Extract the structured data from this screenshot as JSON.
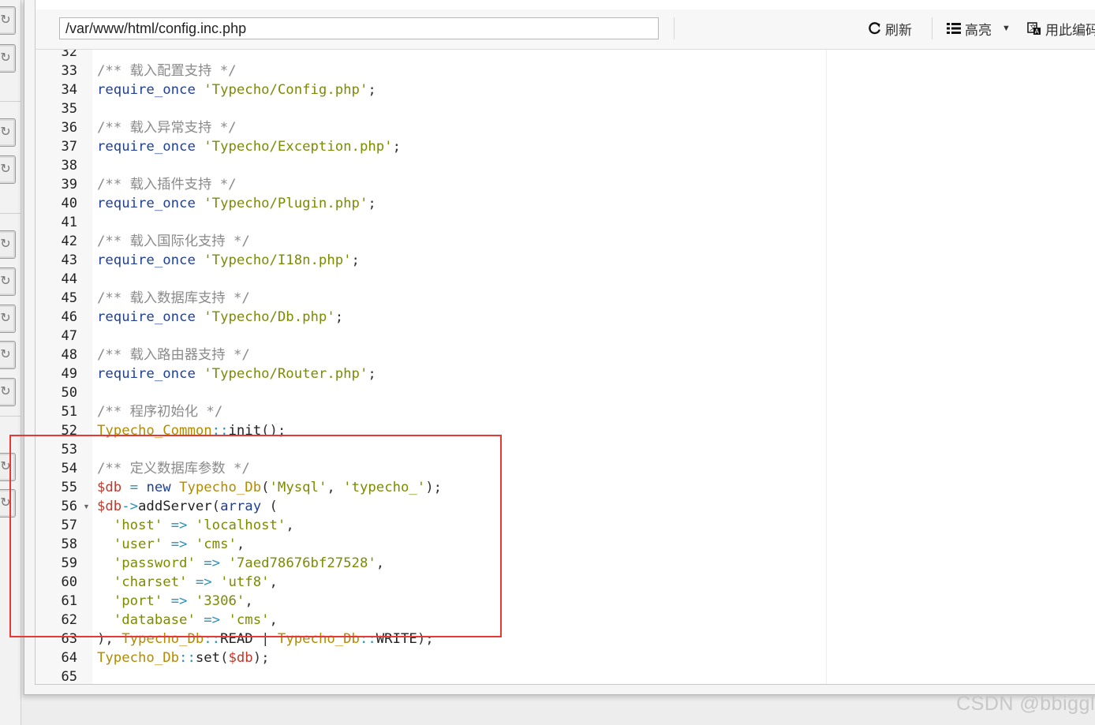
{
  "toolbar": {
    "file_path": "/var/www/html/config.inc.php",
    "refresh_label": "刷新",
    "highlight_label": "高亮",
    "encoding_label": "用此编码"
  },
  "code_lines": [
    {
      "n": "32",
      "t": []
    },
    {
      "n": "33",
      "t": [
        [
          "cm",
          "/** 载入配置支持 */"
        ]
      ]
    },
    {
      "n": "34",
      "t": [
        [
          "kw",
          "require_once"
        ],
        [
          "op",
          " "
        ],
        [
          "str",
          "'Typecho/Config.php'"
        ],
        [
          "op",
          ";"
        ]
      ]
    },
    {
      "n": "35",
      "t": []
    },
    {
      "n": "36",
      "t": [
        [
          "cm",
          "/** 载入异常支持 */"
        ]
      ]
    },
    {
      "n": "37",
      "t": [
        [
          "kw",
          "require_once"
        ],
        [
          "op",
          " "
        ],
        [
          "str",
          "'Typecho/Exception.php'"
        ],
        [
          "op",
          ";"
        ]
      ]
    },
    {
      "n": "38",
      "t": []
    },
    {
      "n": "39",
      "t": [
        [
          "cm",
          "/** 载入插件支持 */"
        ]
      ]
    },
    {
      "n": "40",
      "t": [
        [
          "kw",
          "require_once"
        ],
        [
          "op",
          " "
        ],
        [
          "str",
          "'Typecho/Plugin.php'"
        ],
        [
          "op",
          ";"
        ]
      ]
    },
    {
      "n": "41",
      "t": []
    },
    {
      "n": "42",
      "t": [
        [
          "cm",
          "/** 载入国际化支持 */"
        ]
      ]
    },
    {
      "n": "43",
      "t": [
        [
          "kw",
          "require_once"
        ],
        [
          "op",
          " "
        ],
        [
          "str",
          "'Typecho/I18n.php'"
        ],
        [
          "op",
          ";"
        ]
      ]
    },
    {
      "n": "44",
      "t": []
    },
    {
      "n": "45",
      "t": [
        [
          "cm",
          "/** 载入数据库支持 */"
        ]
      ]
    },
    {
      "n": "46",
      "t": [
        [
          "kw",
          "require_once"
        ],
        [
          "op",
          " "
        ],
        [
          "str",
          "'Typecho/Db.php'"
        ],
        [
          "op",
          ";"
        ]
      ]
    },
    {
      "n": "47",
      "t": []
    },
    {
      "n": "48",
      "t": [
        [
          "cm",
          "/** 载入路由器支持 */"
        ]
      ]
    },
    {
      "n": "49",
      "t": [
        [
          "kw",
          "require_once"
        ],
        [
          "op",
          " "
        ],
        [
          "str",
          "'Typecho/Router.php'"
        ],
        [
          "op",
          ";"
        ]
      ]
    },
    {
      "n": "50",
      "t": []
    },
    {
      "n": "51",
      "t": [
        [
          "cm",
          "/** 程序初始化 */"
        ]
      ]
    },
    {
      "n": "52",
      "t": [
        [
          "cls",
          "Typecho_Common"
        ],
        [
          "arr",
          "::"
        ],
        [
          "fn",
          "init"
        ],
        [
          "op",
          "();"
        ]
      ]
    },
    {
      "n": "53",
      "t": []
    },
    {
      "n": "54",
      "t": [
        [
          "cm",
          "/** 定义数据库参数 */"
        ]
      ]
    },
    {
      "n": "55",
      "t": [
        [
          "var",
          "$db"
        ],
        [
          "op",
          " "
        ],
        [
          "arr",
          "="
        ],
        [
          "op",
          " "
        ],
        [
          "kw",
          "new"
        ],
        [
          "op",
          " "
        ],
        [
          "cls",
          "Typecho_Db"
        ],
        [
          "op",
          "("
        ],
        [
          "str",
          "'Mysql'"
        ],
        [
          "op",
          ", "
        ],
        [
          "str",
          "'typecho_'"
        ],
        [
          "op",
          ");"
        ]
      ]
    },
    {
      "n": "56",
      "fold": true,
      "t": [
        [
          "var",
          "$db"
        ],
        [
          "arr",
          "->"
        ],
        [
          "fn",
          "addServer"
        ],
        [
          "op",
          "("
        ],
        [
          "kw",
          "array"
        ],
        [
          "op",
          " ("
        ]
      ]
    },
    {
      "n": "57",
      "t": [
        [
          "op",
          "  "
        ],
        [
          "str",
          "'host'"
        ],
        [
          "op",
          " "
        ],
        [
          "arr",
          "=>"
        ],
        [
          "op",
          " "
        ],
        [
          "str",
          "'localhost'"
        ],
        [
          "op",
          ","
        ]
      ]
    },
    {
      "n": "58",
      "t": [
        [
          "op",
          "  "
        ],
        [
          "str",
          "'user'"
        ],
        [
          "op",
          " "
        ],
        [
          "arr",
          "=>"
        ],
        [
          "op",
          " "
        ],
        [
          "str",
          "'cms'"
        ],
        [
          "op",
          ","
        ]
      ]
    },
    {
      "n": "59",
      "t": [
        [
          "op",
          "  "
        ],
        [
          "str",
          "'password'"
        ],
        [
          "op",
          " "
        ],
        [
          "arr",
          "=>"
        ],
        [
          "op",
          " "
        ],
        [
          "str",
          "'7aed78676bf27528'"
        ],
        [
          "op",
          ","
        ]
      ]
    },
    {
      "n": "60",
      "t": [
        [
          "op",
          "  "
        ],
        [
          "str",
          "'charset'"
        ],
        [
          "op",
          " "
        ],
        [
          "arr",
          "=>"
        ],
        [
          "op",
          " "
        ],
        [
          "str",
          "'utf8'"
        ],
        [
          "op",
          ","
        ]
      ]
    },
    {
      "n": "61",
      "t": [
        [
          "op",
          "  "
        ],
        [
          "str",
          "'port'"
        ],
        [
          "op",
          " "
        ],
        [
          "arr",
          "=>"
        ],
        [
          "op",
          " "
        ],
        [
          "str",
          "'3306'"
        ],
        [
          "op",
          ","
        ]
      ]
    },
    {
      "n": "62",
      "t": [
        [
          "op",
          "  "
        ],
        [
          "str",
          "'database'"
        ],
        [
          "op",
          " "
        ],
        [
          "arr",
          "=>"
        ],
        [
          "op",
          " "
        ],
        [
          "str",
          "'cms'"
        ],
        [
          "op",
          ","
        ]
      ]
    },
    {
      "n": "63",
      "t": [
        [
          "op",
          "), "
        ],
        [
          "cls",
          "Typecho_Db"
        ],
        [
          "arr",
          "::"
        ],
        [
          "fn",
          "READ"
        ],
        [
          "op",
          " | "
        ],
        [
          "cls",
          "Typecho_Db"
        ],
        [
          "arr",
          "::"
        ],
        [
          "fn",
          "WRITE"
        ],
        [
          "op",
          ");"
        ]
      ]
    },
    {
      "n": "64",
      "t": [
        [
          "cls",
          "Typecho_Db"
        ],
        [
          "arr",
          "::"
        ],
        [
          "fn",
          "set"
        ],
        [
          "op",
          "("
        ],
        [
          "var",
          "$db"
        ],
        [
          "op",
          ");"
        ]
      ]
    },
    {
      "n": "65",
      "t": []
    }
  ],
  "watermark": "CSDN @bbiggl",
  "colors": {
    "highlight_box": "#e53935",
    "keyword": "#1f3f99",
    "string": "#7a8c00",
    "variable": "#c0392b",
    "class": "#b38a00",
    "operator": "#2f8fb5",
    "comment": "#8a8a8a"
  }
}
